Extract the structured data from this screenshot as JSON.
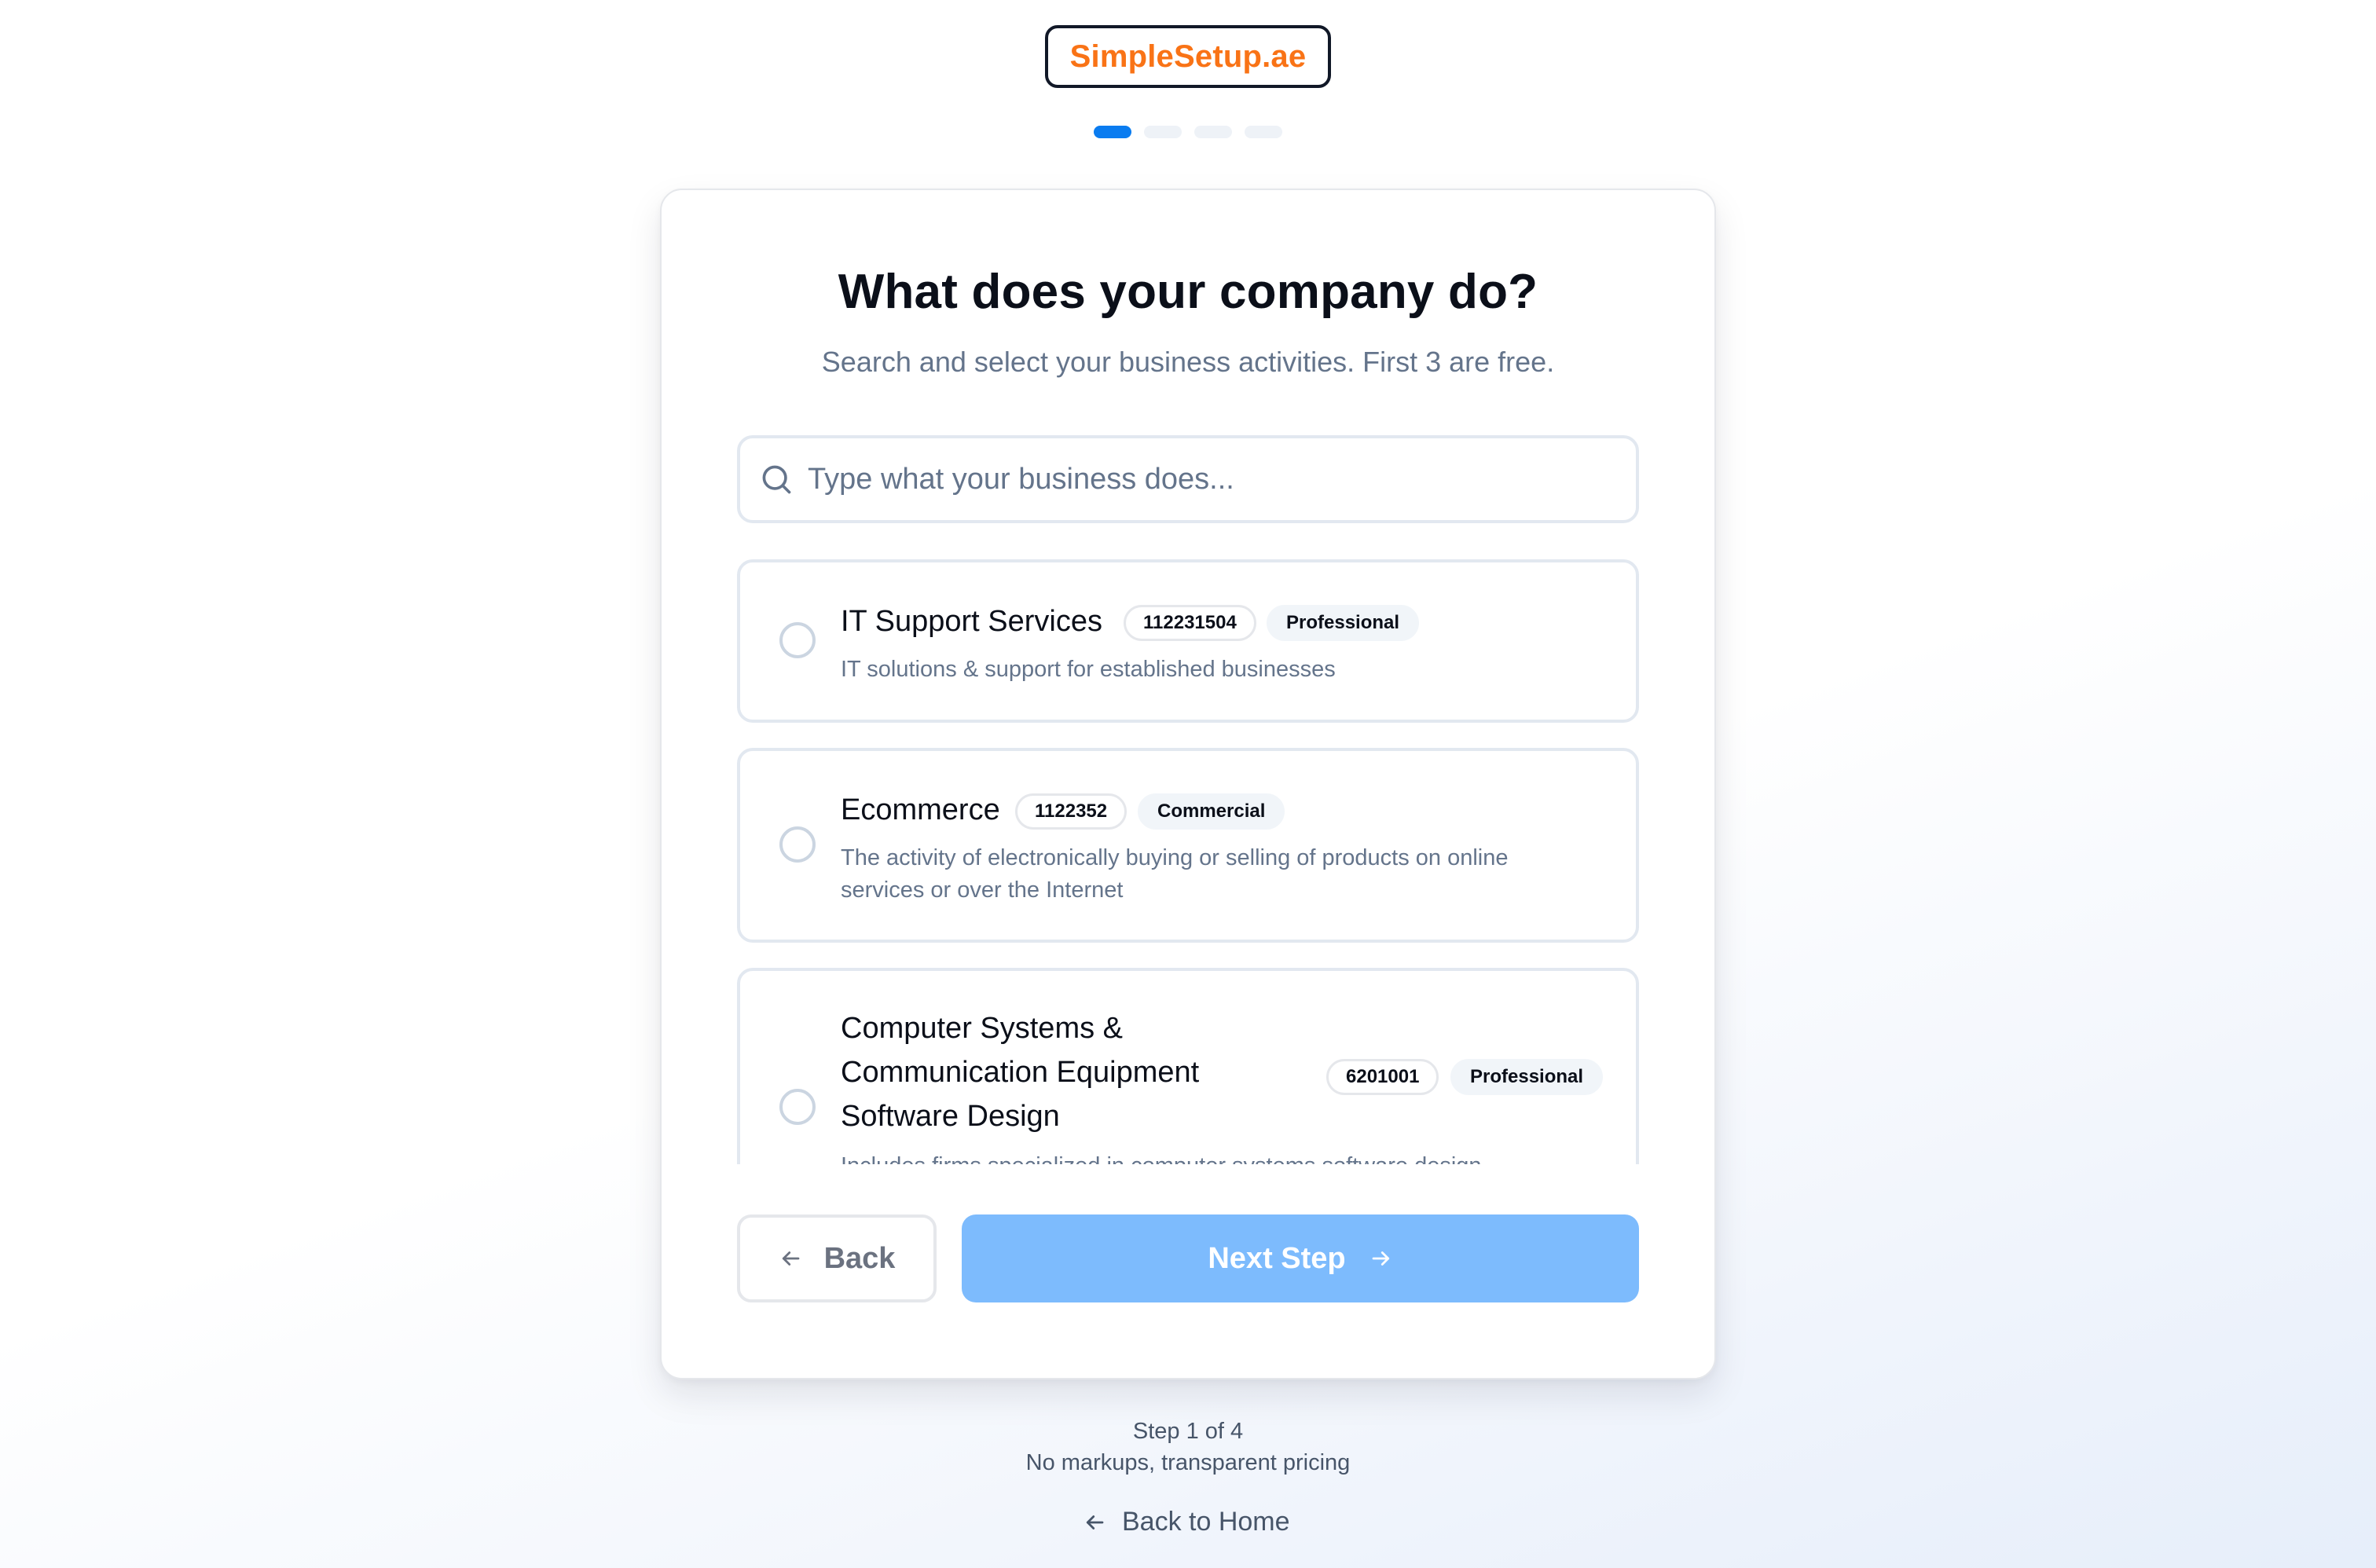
{
  "brand": {
    "logo_text": "SimpleSetup.ae",
    "color": "#f97316"
  },
  "progress": {
    "current_step": 1,
    "total_steps": 4,
    "active_color": "#0a7cf0"
  },
  "header": {
    "title": "What does your company do?",
    "subtitle": "Search and select your business activities. First 3 are free."
  },
  "search": {
    "placeholder": "Type what your business does...",
    "value": "",
    "icon": "search-icon"
  },
  "activities": [
    {
      "name": "IT Support Services",
      "code": "112231504",
      "category": "Professional",
      "description": "IT solutions & support for established businesses",
      "selected": false
    },
    {
      "name": "Ecommerce",
      "code": "1122352",
      "category": "Commercial",
      "description_line1": "The activity of electronically buying or selling of products on online",
      "description_line2": "services or over the Internet",
      "selected": false
    },
    {
      "name_line1": "Computer Systems &",
      "name_line2": "Communication Equipment",
      "name_line3": "Software Design",
      "code": "6201001",
      "category": "Professional",
      "description": "Includes firms specialized in computer systems software design",
      "selected": false
    }
  ],
  "actions": {
    "back_label": "Back",
    "next_label": "Next Step",
    "next_color": "#7dbbfd"
  },
  "footer": {
    "step_text": "Step 1 of 4",
    "tagline": "No markups, transparent pricing",
    "back_home_label": "Back to Home"
  }
}
